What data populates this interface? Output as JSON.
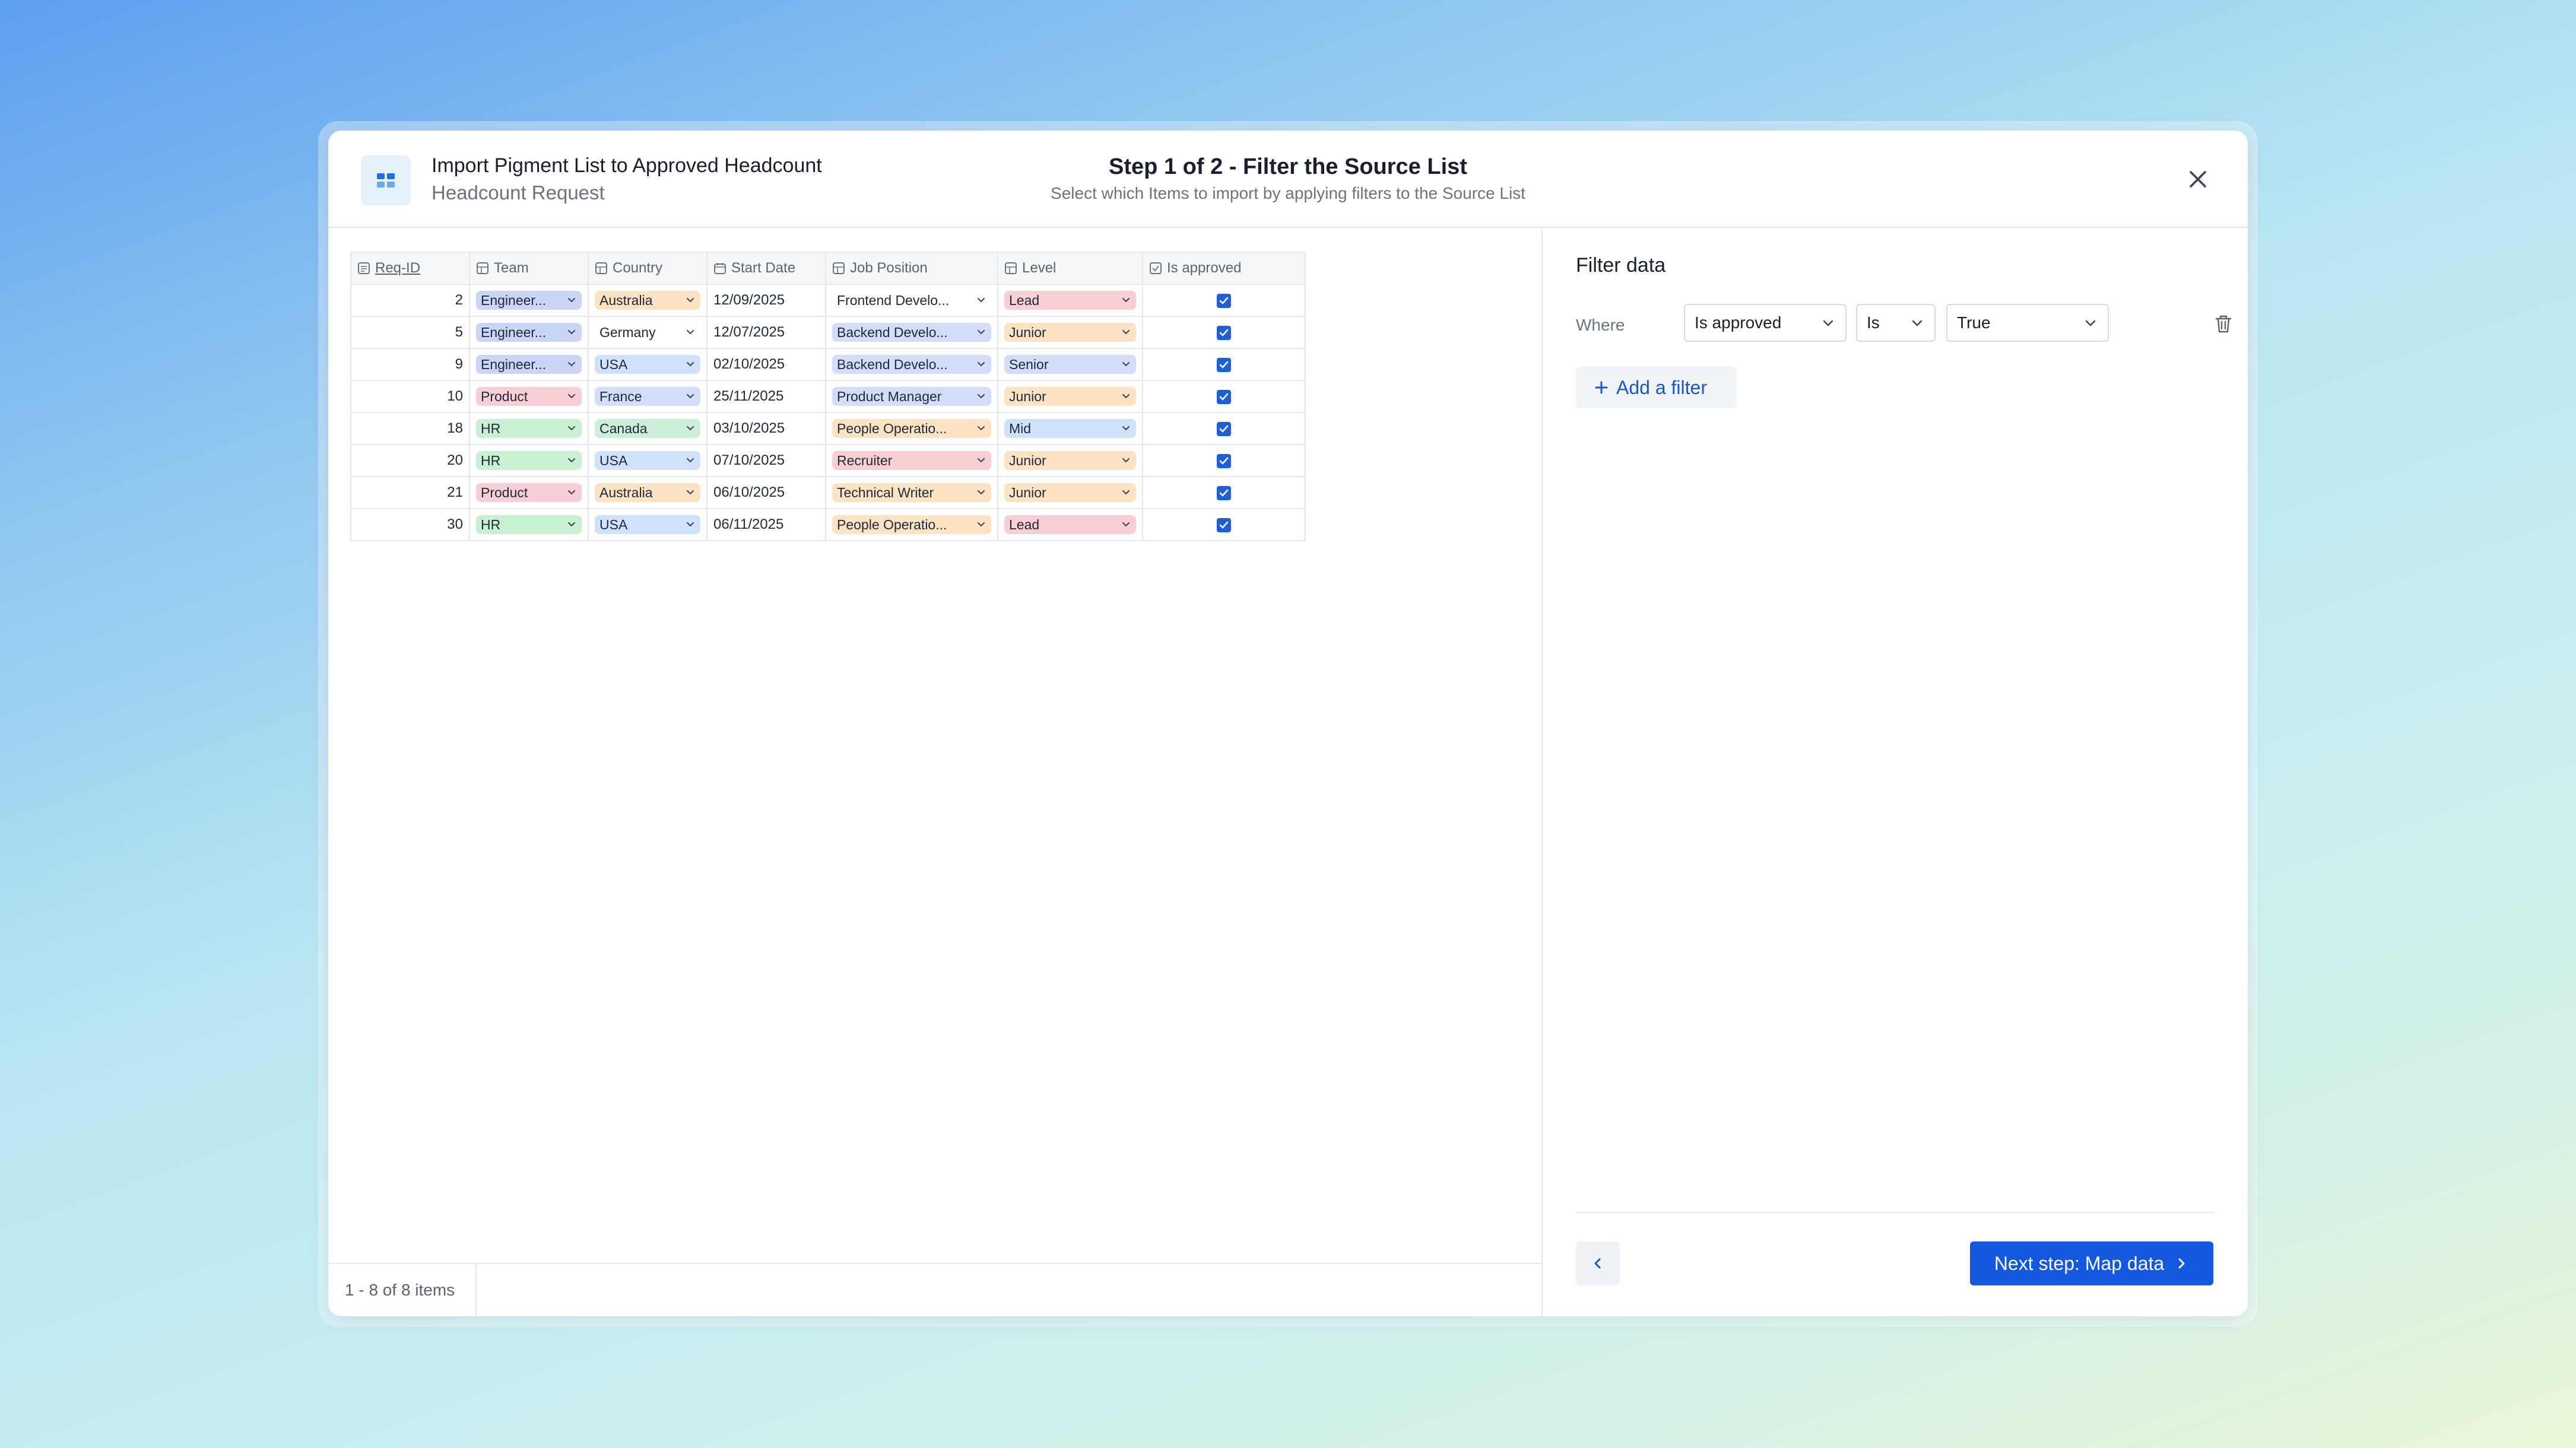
{
  "header": {
    "title": "Import Pigment List to Approved Headcount",
    "subtitle": "Headcount Request",
    "step_title": "Step 1 of 2 - Filter the Source List",
    "step_subtitle": "Select which Items to import by applying filters to the Source List"
  },
  "table": {
    "columns": [
      "Req-ID",
      "Team",
      "Country",
      "Start Date",
      "Job Position",
      "Level",
      "Is approved"
    ],
    "rows": [
      {
        "id": "2",
        "team": "Engineer...",
        "country": "Australia",
        "date": "12/09/2025",
        "position": "Frontend Develo...",
        "level": "Lead",
        "approved": true
      },
      {
        "id": "5",
        "team": "Engineer...",
        "country": "Germany",
        "date": "12/07/2025",
        "position": "Backend Develo...",
        "level": "Junior",
        "approved": true
      },
      {
        "id": "9",
        "team": "Engineer...",
        "country": "USA",
        "date": "02/10/2025",
        "position": "Backend Develo...",
        "level": "Senior",
        "approved": true
      },
      {
        "id": "10",
        "team": "Product",
        "country": "France",
        "date": "25/11/2025",
        "position": "Product Manager",
        "level": "Junior",
        "approved": true
      },
      {
        "id": "18",
        "team": "HR",
        "country": "Canada",
        "date": "03/10/2025",
        "position": "People Operatio...",
        "level": "Mid",
        "approved": true
      },
      {
        "id": "20",
        "team": "HR",
        "country": "USA",
        "date": "07/10/2025",
        "position": "Recruiter",
        "level": "Junior",
        "approved": true
      },
      {
        "id": "21",
        "team": "Product",
        "country": "Australia",
        "date": "06/10/2025",
        "position": "Technical Writer",
        "level": "Junior",
        "approved": true
      },
      {
        "id": "30",
        "team": "HR",
        "country": "USA",
        "date": "06/11/2025",
        "position": "People Operatio...",
        "level": "Lead",
        "approved": true
      }
    ],
    "pager": "1 - 8 of 8 items"
  },
  "tag_colors": {
    "team": {
      "Engineer...": "#cbd5f7",
      "Product": "#f9cfd6",
      "HR": "#c8f0d2"
    },
    "country": {
      "Australia": "#fbe3c4",
      "Germany": "transparent",
      "USA": "#cfe2f9",
      "France": "#d5dcf8",
      "Canada": "#cdeed8"
    },
    "position": {
      "Frontend Develo...": "transparent",
      "Backend Develo...": "#d5dcf8",
      "Product Manager": "#d5dcf8",
      "People Operatio...": "#fbe3c4",
      "Recruiter": "#f9cfd6",
      "Technical Writer": "#fbe3c4"
    },
    "level": {
      "Lead": "#f9cfd6",
      "Junior": "#fbe3c4",
      "Senior": "#d5dcf8",
      "Mid": "#cfe2f9"
    }
  },
  "filter": {
    "title": "Filter data",
    "where_label": "Where",
    "field": "Is approved",
    "operator": "Is",
    "value": "True",
    "add_filter_label": "Add a filter"
  },
  "footer": {
    "next_label": "Next step: Map data"
  },
  "icons": {
    "app": "grid-app-icon",
    "close": "close-icon",
    "trash": "trash-icon",
    "back": "chevron-left-icon",
    "next": "chevron-right-icon"
  },
  "colors": {
    "primary": "#1558e0",
    "checkbox": "#1f5fd6"
  }
}
